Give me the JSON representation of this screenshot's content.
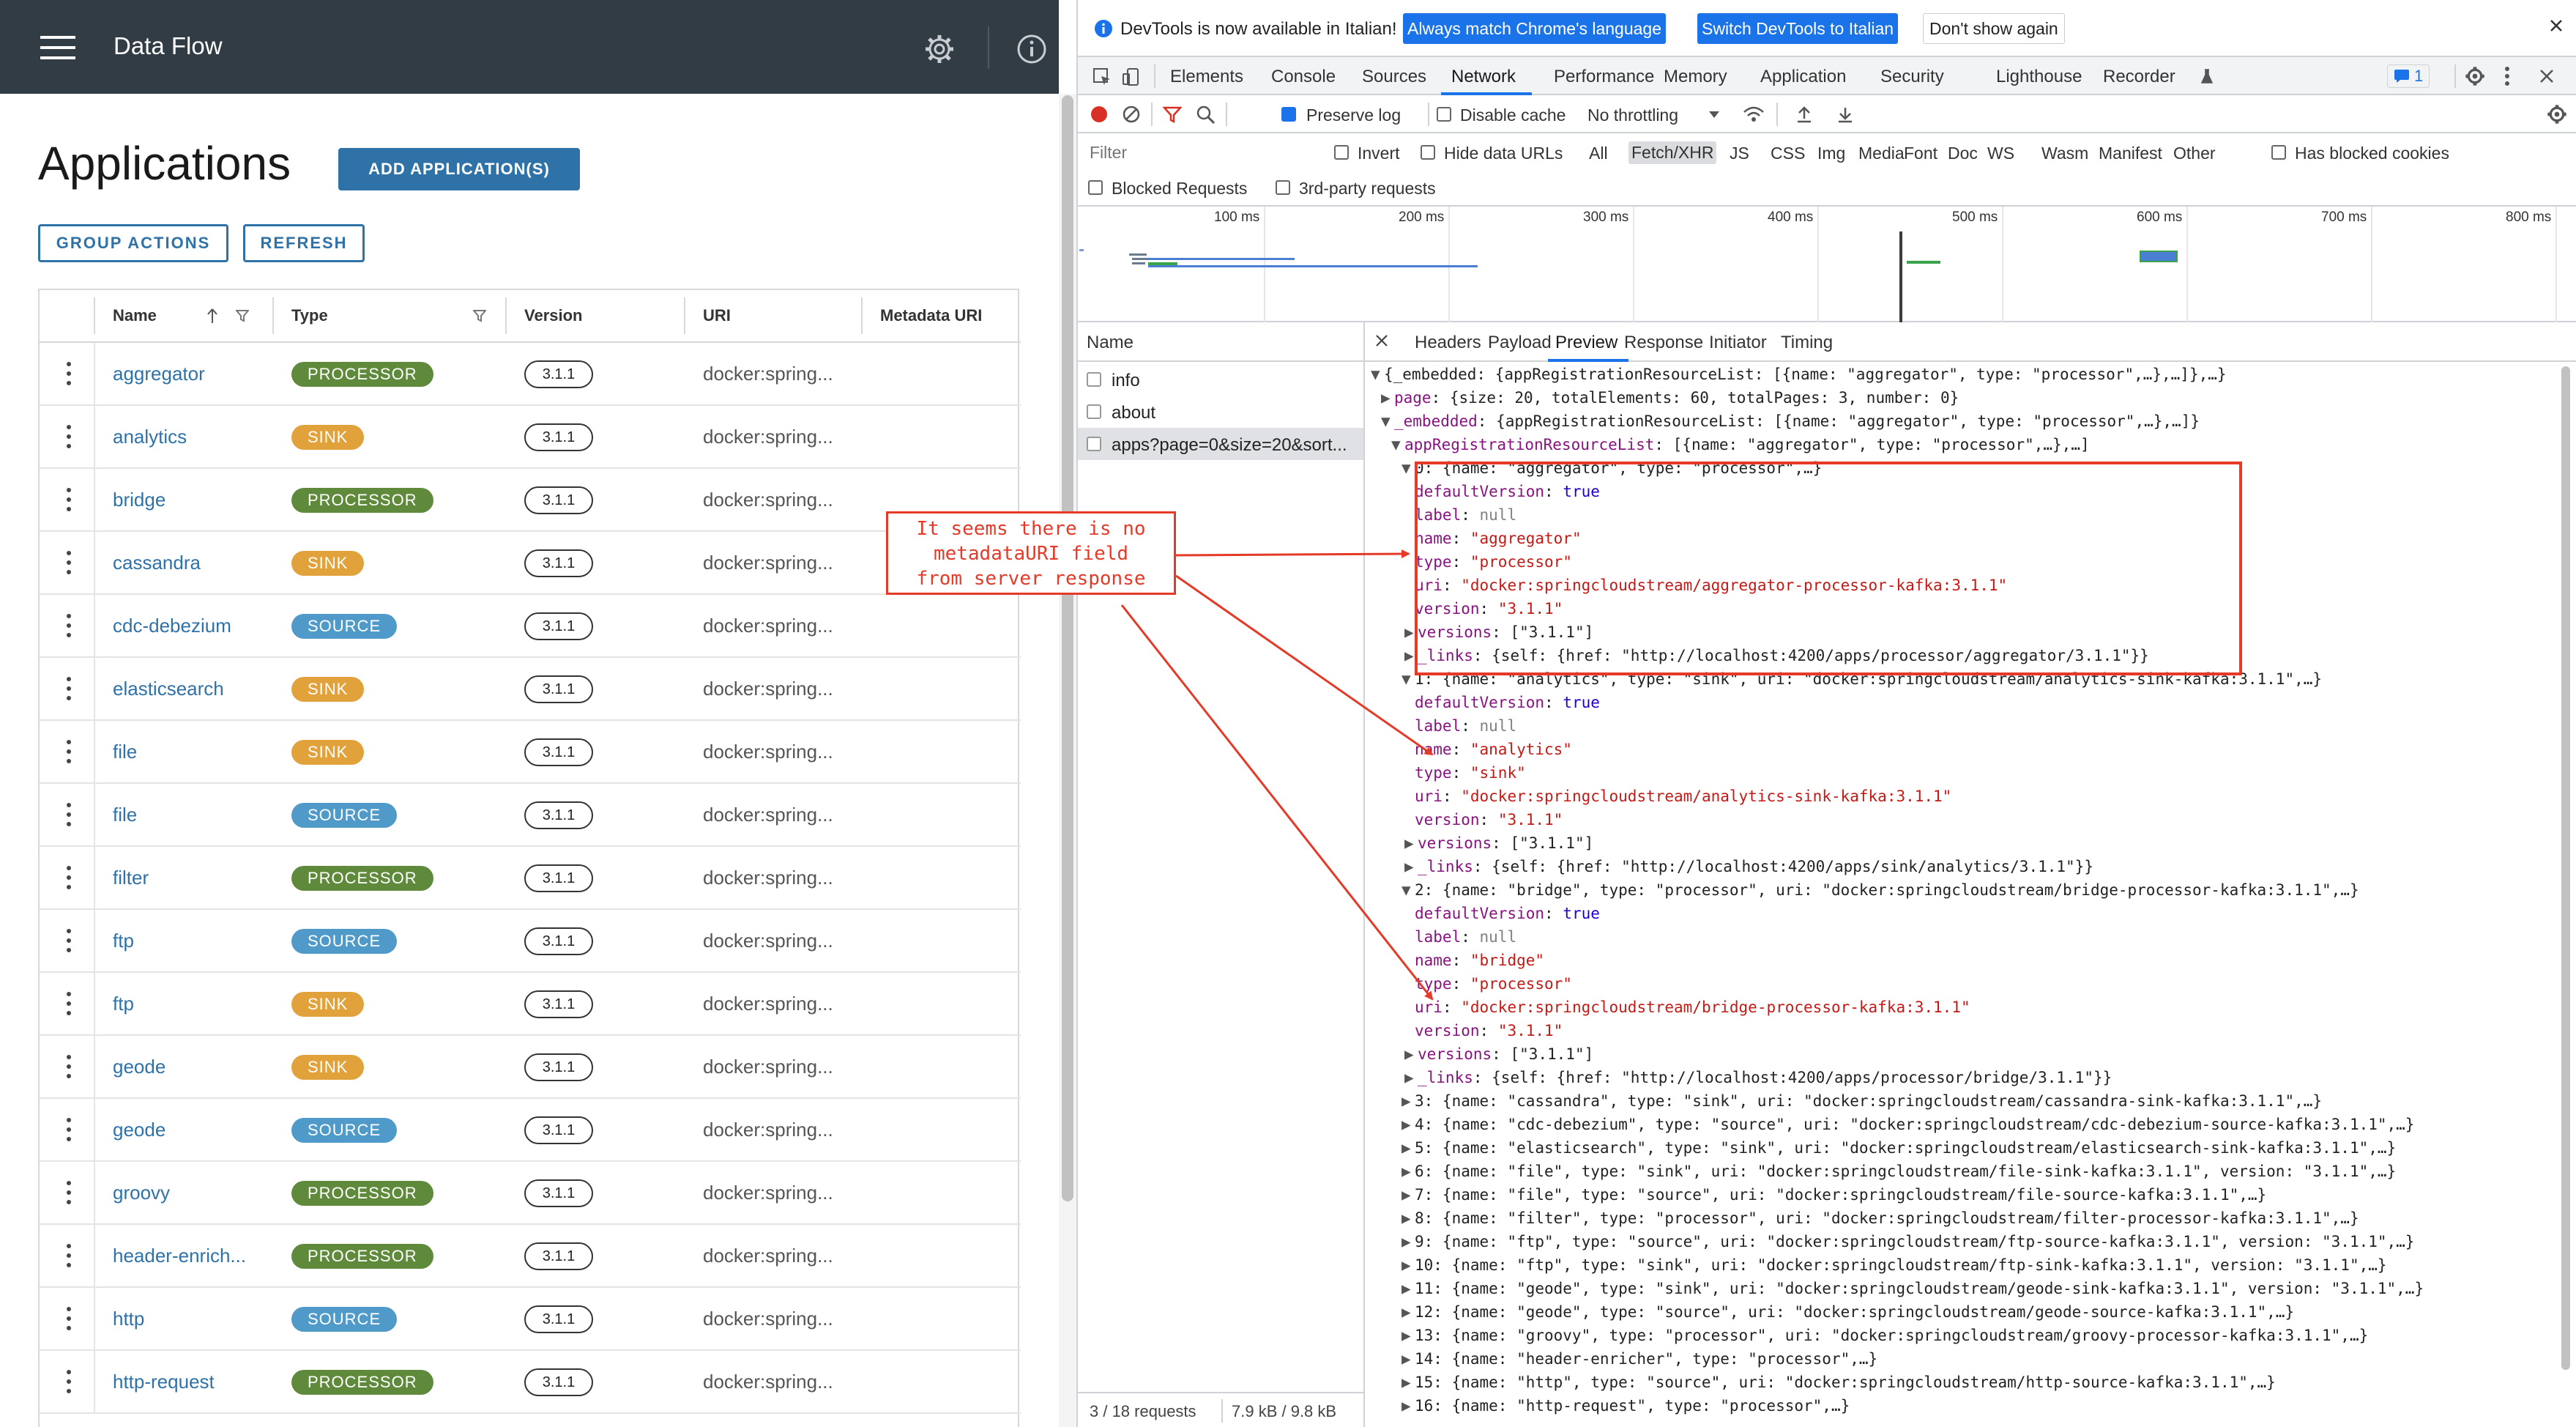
{
  "app": {
    "title": "Data Flow",
    "page_title": "Applications",
    "add_button": "ADD APPLICATION(S)",
    "group_actions": "GROUP ACTIONS",
    "refresh": "REFRESH",
    "columns": [
      "Name",
      "Type",
      "Version",
      "URI",
      "Metadata URI"
    ],
    "rows": [
      {
        "name": "aggregator",
        "type": "PROCESSOR",
        "version": "3.1.1",
        "uri": "docker:spring..."
      },
      {
        "name": "analytics",
        "type": "SINK",
        "version": "3.1.1",
        "uri": "docker:spring..."
      },
      {
        "name": "bridge",
        "type": "PROCESSOR",
        "version": "3.1.1",
        "uri": "docker:spring..."
      },
      {
        "name": "cassandra",
        "type": "SINK",
        "version": "3.1.1",
        "uri": "docker:spring..."
      },
      {
        "name": "cdc-debezium",
        "type": "SOURCE",
        "version": "3.1.1",
        "uri": "docker:spring..."
      },
      {
        "name": "elasticsearch",
        "type": "SINK",
        "version": "3.1.1",
        "uri": "docker:spring..."
      },
      {
        "name": "file",
        "type": "SINK",
        "version": "3.1.1",
        "uri": "docker:spring..."
      },
      {
        "name": "file",
        "type": "SOURCE",
        "version": "3.1.1",
        "uri": "docker:spring..."
      },
      {
        "name": "filter",
        "type": "PROCESSOR",
        "version": "3.1.1",
        "uri": "docker:spring..."
      },
      {
        "name": "ftp",
        "type": "SOURCE",
        "version": "3.1.1",
        "uri": "docker:spring..."
      },
      {
        "name": "ftp",
        "type": "SINK",
        "version": "3.1.1",
        "uri": "docker:spring..."
      },
      {
        "name": "geode",
        "type": "SINK",
        "version": "3.1.1",
        "uri": "docker:spring..."
      },
      {
        "name": "geode",
        "type": "SOURCE",
        "version": "3.1.1",
        "uri": "docker:spring..."
      },
      {
        "name": "groovy",
        "type": "PROCESSOR",
        "version": "3.1.1",
        "uri": "docker:spring..."
      },
      {
        "name": "header-enrich...",
        "type": "PROCESSOR",
        "version": "3.1.1",
        "uri": "docker:spring..."
      },
      {
        "name": "http",
        "type": "SOURCE",
        "version": "3.1.1",
        "uri": "docker:spring..."
      },
      {
        "name": "http-request",
        "type": "PROCESSOR",
        "version": "3.1.1",
        "uri": "docker:spring..."
      }
    ],
    "colors": {
      "PROCESSOR": "#5f8a3b",
      "SINK": "#e1a23c",
      "SOURCE": "#4f9ac9",
      "header": "#313c45",
      "accent": "#2f72a8"
    }
  },
  "devtools": {
    "notification": {
      "text": "DevTools is now available in Italian!",
      "btn_match": "Always match Chrome's language",
      "btn_switch": "Switch DevTools to Italian",
      "btn_dismiss": "Don't show again"
    },
    "tabs": [
      "Elements",
      "Console",
      "Sources",
      "Network",
      "Performance",
      "Memory",
      "Application",
      "Security",
      "Lighthouse",
      "Recorder"
    ],
    "active_tab": "Network",
    "issues_count": "1",
    "toolbar": {
      "preserve_log": "Preserve log",
      "disable_cache": "Disable cache",
      "throttling": "No throttling"
    },
    "filter": {
      "placeholder": "Filter",
      "invert": "Invert",
      "hide_data_urls": "Hide data URLs",
      "types": [
        "All",
        "Fetch/XHR",
        "JS",
        "CSS",
        "Img",
        "Media",
        "Font",
        "Doc",
        "WS",
        "Wasm",
        "Manifest",
        "Other"
      ],
      "active_type": "Fetch/XHR",
      "has_blocked_cookies": "Has blocked cookies",
      "blocked_requests": "Blocked Requests",
      "third_party": "3rd-party requests"
    },
    "timeline_ticks": [
      "100 ms",
      "200 ms",
      "300 ms",
      "400 ms",
      "500 ms",
      "600 ms",
      "700 ms",
      "800 ms"
    ],
    "requests_header": "Name",
    "requests": [
      "info",
      "about",
      "apps?page=0&size=20&sort..."
    ],
    "detail_tabs": [
      "Headers",
      "Payload",
      "Preview",
      "Response",
      "Initiator",
      "Timing"
    ],
    "active_detail_tab": "Preview",
    "status": {
      "requests": "3 / 18 requests",
      "size": "7.9 kB / 9.8 kB"
    },
    "preview": {
      "l0": "{_embedded: {appRegistrationResourceList: [{name: \"aggregator\", type: \"processor\",…},…]},…}",
      "l1k": "page",
      "l1v": ": {size: 20, totalElements: 60, totalPages: 3, number: 0}",
      "l2k": "_embedded",
      "l2v": ": {appRegistrationResourceList: [{name: \"aggregator\", type: \"processor\",…},…]}",
      "l3k": "appRegistrationResourceList",
      "l3v": ": [{name: \"aggregator\", type: \"processor\",…},…]",
      "items_open": [
        {
          "head": "0: {name: \"aggregator\", type: \"processor\",…}",
          "defaultVersion": "true",
          "label": "null",
          "name": "\"aggregator\"",
          "type": "\"processor\"",
          "uri": "\"docker:springcloudstream/aggregator-processor-kafka:3.1.1\"",
          "version": "\"3.1.1\"",
          "versions": "[\"3.1.1\"]",
          "links": "{self: {href: \"http://localhost:4200/apps/processor/aggregator/3.1.1\"}}"
        },
        {
          "head": "1: {name: \"analytics\", type: \"sink\", uri: \"docker:springcloudstream/analytics-sink-kafka:3.1.1\",…}",
          "defaultVersion": "true",
          "label": "null",
          "name": "\"analytics\"",
          "type": "\"sink\"",
          "uri": "\"docker:springcloudstream/analytics-sink-kafka:3.1.1\"",
          "version": "\"3.1.1\"",
          "versions": "[\"3.1.1\"]",
          "links": "{self: {href: \"http://localhost:4200/apps/sink/analytics/3.1.1\"}}"
        },
        {
          "head": "2: {name: \"bridge\", type: \"processor\", uri: \"docker:springcloudstream/bridge-processor-kafka:3.1.1\",…}",
          "defaultVersion": "true",
          "label": "null",
          "name": "\"bridge\"",
          "type": "\"processor\"",
          "uri": "\"docker:springcloudstream/bridge-processor-kafka:3.1.1\"",
          "version": "\"3.1.1\"",
          "versions": "[\"3.1.1\"]",
          "links": "{self: {href: \"http://localhost:4200/apps/processor/bridge/3.1.1\"}}"
        }
      ],
      "items_collapsed": [
        "3: {name: \"cassandra\", type: \"sink\", uri: \"docker:springcloudstream/cassandra-sink-kafka:3.1.1\",…}",
        "4: {name: \"cdc-debezium\", type: \"source\", uri: \"docker:springcloudstream/cdc-debezium-source-kafka:3.1.1\",…}",
        "5: {name: \"elasticsearch\", type: \"sink\", uri: \"docker:springcloudstream/elasticsearch-sink-kafka:3.1.1\",…}",
        "6: {name: \"file\", type: \"sink\", uri: \"docker:springcloudstream/file-sink-kafka:3.1.1\", version: \"3.1.1\",…}",
        "7: {name: \"file\", type: \"source\", uri: \"docker:springcloudstream/file-source-kafka:3.1.1\",…}",
        "8: {name: \"filter\", type: \"processor\", uri: \"docker:springcloudstream/filter-processor-kafka:3.1.1\",…}",
        "9: {name: \"ftp\", type: \"source\", uri: \"docker:springcloudstream/ftp-source-kafka:3.1.1\", version: \"3.1.1\",…}",
        "10: {name: \"ftp\", type: \"sink\", uri: \"docker:springcloudstream/ftp-sink-kafka:3.1.1\", version: \"3.1.1\",…}",
        "11: {name: \"geode\", type: \"sink\", uri: \"docker:springcloudstream/geode-sink-kafka:3.1.1\", version: \"3.1.1\",…}",
        "12: {name: \"geode\", type: \"source\", uri: \"docker:springcloudstream/geode-source-kafka:3.1.1\",…}",
        "13: {name: \"groovy\", type: \"processor\", uri: \"docker:springcloudstream/groovy-processor-kafka:3.1.1\",…}",
        "14: {name: \"header-enricher\", type: \"processor\",…}",
        "15: {name: \"http\", type: \"source\", uri: \"docker:springcloudstream/http-source-kafka:3.1.1\",…}",
        "16: {name: \"http-request\", type: \"processor\",…}"
      ]
    }
  },
  "annotation": {
    "lines": [
      "It seems there is no",
      "metadataURI field",
      "from server response"
    ],
    "color": "#e53a28"
  }
}
